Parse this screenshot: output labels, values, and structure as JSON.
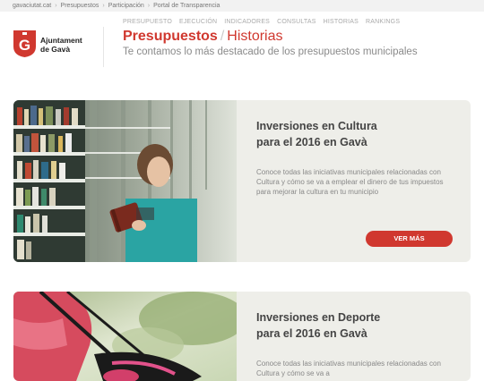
{
  "breadcrumb": [
    "gavaciutat.cat",
    "Presupuestos",
    "Participación",
    "Portal de Transparencia"
  ],
  "logo": {
    "line1": "Ajuntament",
    "line2": "de Gavà"
  },
  "nav": [
    "PRESUPUESTO",
    "EJECUCIÓN",
    "INDICADORES",
    "CONSULTAS",
    "HISTORIAS",
    "RANKINGS"
  ],
  "title": {
    "main": "Presupuestos",
    "sub": "Historias"
  },
  "subtitle": "Te contamos lo más destacado de los presupuestos municipales",
  "cards": [
    {
      "title_line1": "Inversiones en Cultura",
      "title_line2": "para el 2016 en Gavà",
      "text": "Conoce todas las iniciativas municipales relacionadas con Cultura y cómo se va a emplear el dinero de tus impuestos para mejorar la cultura en tu municipio",
      "button": "VER MÁS"
    },
    {
      "title_line1": "Inversiones en Deporte",
      "title_line2": "para el 2016 en Gavà",
      "text": "Conoce todas las iniciativas municipales relacionadas con Cultura y cómo se va a"
    }
  ],
  "colors": {
    "accent": "#d0382f",
    "card_bg": "#eeeee9"
  }
}
